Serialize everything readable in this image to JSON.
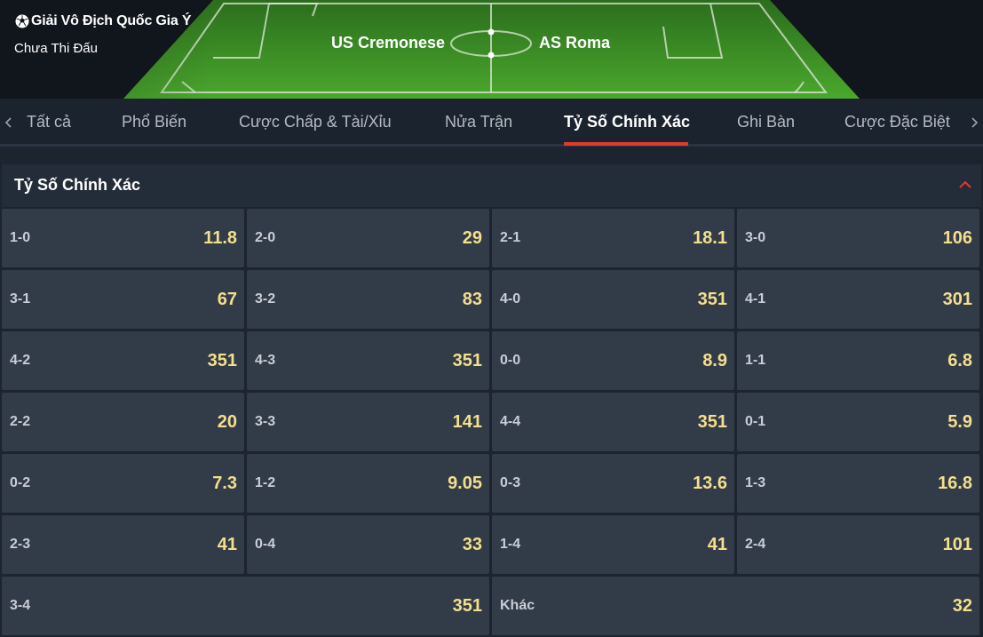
{
  "match": {
    "league": "Giải Vô Địch Quốc Gia Ý",
    "league_icon": "soccer-ball-icon",
    "status": "Chưa Thi Đấu",
    "home_team": "US Cremonese",
    "away_team": "AS Roma"
  },
  "tabs": [
    {
      "label": "Tất cả"
    },
    {
      "label": "Phổ Biến"
    },
    {
      "label": "Cược Chấp & Tài/Xỉu"
    },
    {
      "label": "Nửa Trận"
    },
    {
      "label": "Tỷ Số Chính Xác",
      "active": true
    },
    {
      "label": "Ghi Bàn"
    },
    {
      "label": "Cược Đặc Biệt"
    }
  ],
  "icons": {
    "tab_prev": "chevron-left-icon",
    "tab_next": "chevron-right-icon",
    "collapse": "chevron-up-icon"
  },
  "section": {
    "title": "Tỷ Số Chính Xác"
  },
  "scores": [
    {
      "score": "1-0",
      "odds": "11.8"
    },
    {
      "score": "2-0",
      "odds": "29"
    },
    {
      "score": "2-1",
      "odds": "18.1"
    },
    {
      "score": "3-0",
      "odds": "106"
    },
    {
      "score": "3-1",
      "odds": "67"
    },
    {
      "score": "3-2",
      "odds": "83"
    },
    {
      "score": "4-0",
      "odds": "351"
    },
    {
      "score": "4-1",
      "odds": "301"
    },
    {
      "score": "4-2",
      "odds": "351"
    },
    {
      "score": "4-3",
      "odds": "351"
    },
    {
      "score": "0-0",
      "odds": "8.9"
    },
    {
      "score": "1-1",
      "odds": "6.8"
    },
    {
      "score": "2-2",
      "odds": "20"
    },
    {
      "score": "3-3",
      "odds": "141"
    },
    {
      "score": "4-4",
      "odds": "351"
    },
    {
      "score": "0-1",
      "odds": "5.9"
    },
    {
      "score": "0-2",
      "odds": "7.3"
    },
    {
      "score": "1-2",
      "odds": "9.05"
    },
    {
      "score": "0-3",
      "odds": "13.6"
    },
    {
      "score": "1-3",
      "odds": "16.8"
    },
    {
      "score": "2-3",
      "odds": "41"
    },
    {
      "score": "0-4",
      "odds": "33"
    },
    {
      "score": "1-4",
      "odds": "41"
    },
    {
      "score": "2-4",
      "odds": "101"
    },
    {
      "score": "3-4",
      "odds": "351",
      "wide": true
    },
    {
      "score": "Khác",
      "odds": "32",
      "wide": true
    }
  ],
  "colors": {
    "accent": "#e23b2e",
    "odds": "#f4df8c",
    "cell_bg": "#323b48",
    "pitch": "#3f9a26"
  }
}
